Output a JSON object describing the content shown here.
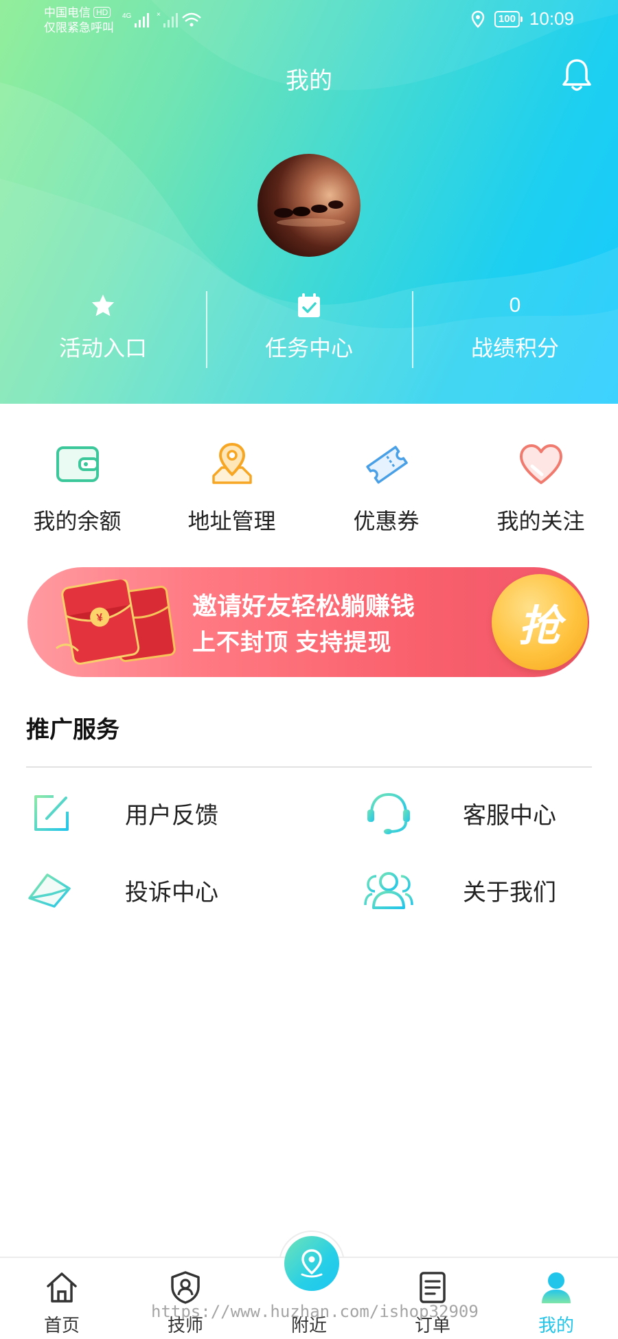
{
  "status_bar": {
    "carrier": "中国电信",
    "hd_badge": "HD",
    "emergency": "仅限紧急呼叫",
    "network": "4G",
    "battery": "100",
    "time": "10:09"
  },
  "header": {
    "title": "我的",
    "stats": [
      {
        "icon": "star-icon",
        "value": "",
        "label": "活动入口"
      },
      {
        "icon": "calendar-check-icon",
        "value": "",
        "label": "任务中心"
      },
      {
        "icon": "",
        "value": "0",
        "label": "战绩积分"
      }
    ]
  },
  "quick_actions": [
    {
      "icon": "wallet-icon",
      "label": "我的余额",
      "color": "#3cc79a"
    },
    {
      "icon": "location-pin-icon",
      "label": "地址管理",
      "color": "#f6a623"
    },
    {
      "icon": "ticket-icon",
      "label": "优惠券",
      "color": "#4aa0e6"
    },
    {
      "icon": "heart-icon",
      "label": "我的关注",
      "color": "#f07a6e"
    }
  ],
  "banner": {
    "line1": "邀请好友轻松躺赚钱",
    "line2": "上不封顶  支持提现",
    "button": "抢"
  },
  "services": {
    "title": "推广服务",
    "items": [
      {
        "icon": "edit-icon",
        "label": "用户反馈"
      },
      {
        "icon": "headset-icon",
        "label": "客服中心"
      },
      {
        "icon": "envelope-icon",
        "label": "投诉中心"
      },
      {
        "icon": "users-icon",
        "label": "关于我们"
      }
    ]
  },
  "tabbar": {
    "tabs": [
      {
        "icon": "home-icon",
        "label": "首页"
      },
      {
        "icon": "shield-user-icon",
        "label": "技师"
      },
      {
        "icon": "location-pin-icon",
        "label": "附近"
      },
      {
        "icon": "order-list-icon",
        "label": "订单"
      },
      {
        "icon": "user-icon",
        "label": "我的",
        "active": true
      }
    ],
    "active_color": "#22c5ea"
  },
  "watermark": "https://www.huzhan.com/ishop32909"
}
